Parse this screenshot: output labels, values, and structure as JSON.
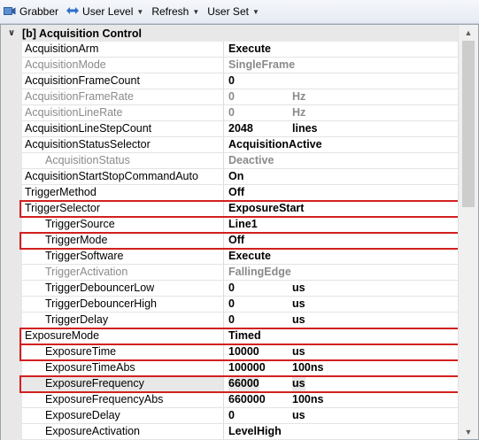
{
  "toolbar": {
    "grabber": "Grabber",
    "user_level": "User Level",
    "refresh": "Refresh",
    "user_set": "User Set"
  },
  "category": {
    "title": "[b] Acquisition Control",
    "toggle": "∨"
  },
  "rows": [
    {
      "name": "AcquisitionArm",
      "value": "Execute",
      "unit": ""
    },
    {
      "name": "AcquisitionMode",
      "value": "SingleFrame",
      "unit": ""
    },
    {
      "name": "AcquisitionFrameCount",
      "value": "0",
      "unit": ""
    },
    {
      "name": "AcquisitionFrameRate",
      "value": "0",
      "unit": "Hz"
    },
    {
      "name": "AcquisitionLineRate",
      "value": "0",
      "unit": "Hz"
    },
    {
      "name": "AcquisitionLineStepCount",
      "value": "2048",
      "unit": "lines"
    },
    {
      "name": "AcquisitionStatusSelector",
      "value": "AcquisitionActive",
      "unit": ""
    },
    {
      "name": "AcquisitionStatus",
      "value": "Deactive",
      "unit": ""
    },
    {
      "name": "AcquisitionStartStopCommandAuto",
      "value": "On",
      "unit": ""
    },
    {
      "name": "TriggerMethod",
      "value": "Off",
      "unit": ""
    },
    {
      "name": "TriggerSelector",
      "value": "ExposureStart",
      "unit": ""
    },
    {
      "name": "TriggerSource",
      "value": "Line1",
      "unit": ""
    },
    {
      "name": "TriggerMode",
      "value": "Off",
      "unit": ""
    },
    {
      "name": "TriggerSoftware",
      "value": "Execute",
      "unit": ""
    },
    {
      "name": "TriggerActivation",
      "value": "FallingEdge",
      "unit": ""
    },
    {
      "name": "TriggerDebouncerLow",
      "value": "0",
      "unit": "us"
    },
    {
      "name": "TriggerDebouncerHigh",
      "value": "0",
      "unit": "us"
    },
    {
      "name": "TriggerDelay",
      "value": "0",
      "unit": "us"
    },
    {
      "name": "ExposureMode",
      "value": "Timed",
      "unit": ""
    },
    {
      "name": "ExposureTime",
      "value": "10000",
      "unit": "us"
    },
    {
      "name": "ExposureTimeAbs",
      "value": "100000",
      "unit": "100ns"
    },
    {
      "name": "ExposureFrequency",
      "value": "66000",
      "unit": "us"
    },
    {
      "name": "ExposureFrequencyAbs",
      "value": "660000",
      "unit": "100ns"
    },
    {
      "name": "ExposureDelay",
      "value": "0",
      "unit": "us"
    },
    {
      "name": "ExposureActivation",
      "value": "LevelHigh",
      "unit": ""
    }
  ],
  "colors": {
    "highlight_border": "#d32020",
    "disabled_text": "#8a8a8a",
    "category_bg": "#e8e8e8"
  }
}
